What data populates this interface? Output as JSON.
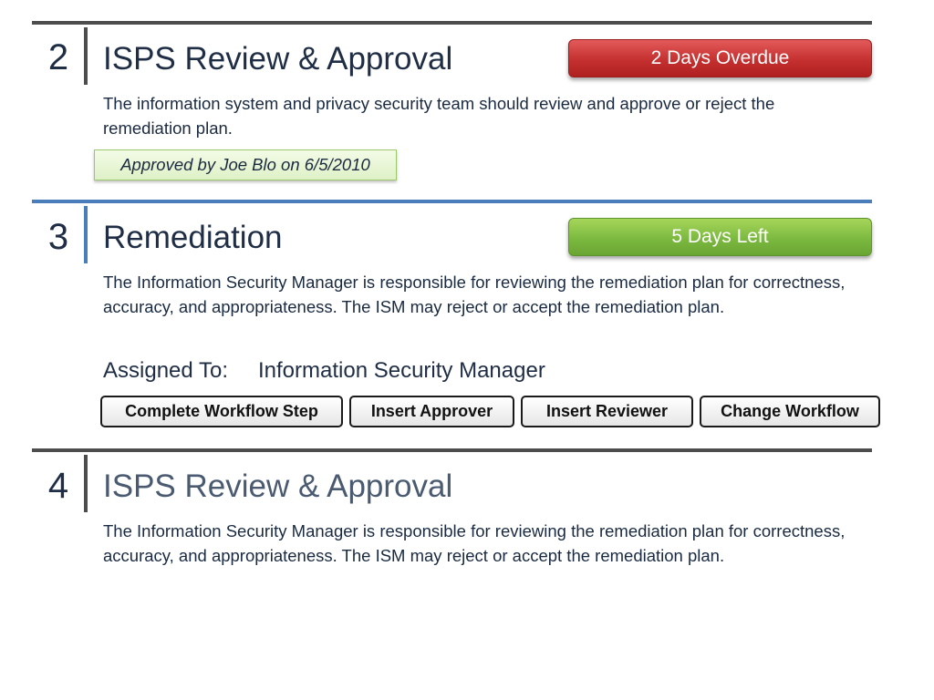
{
  "steps": [
    {
      "number": "2",
      "title": "ISPS Review & Approval",
      "status": "2 Days Overdue",
      "description": "The information system and privacy security team should review and approve or reject the remediation plan.",
      "approval_note": "Approved by Joe Blo on 6/5/2010"
    },
    {
      "number": "3",
      "title": "Remediation",
      "status": "5 Days Left",
      "description": "The Information Security Manager is responsible for reviewing the remediation plan for correctness, accuracy, and appropriateness. The ISM may reject or accept the remediation plan.",
      "assigned_label": "Assigned To:",
      "assigned_value": "Information Security Manager",
      "actions": [
        "Complete Workflow Step",
        "Insert Approver",
        "Insert Reviewer",
        "Change Workflow"
      ]
    },
    {
      "number": "4",
      "title": "ISPS Review & Approval",
      "description": "The Information Security Manager is responsible for reviewing the remediation plan for correctness, accuracy, and appropriateness. The ISM may reject or accept the remediation plan."
    }
  ],
  "colors": {
    "overdue": "#c53030",
    "days_left": "#7cb940",
    "active_rule": "#4a7ebb",
    "inactive_rule": "#4d4d4d",
    "approval_note_bg": "#e8f5d6"
  }
}
